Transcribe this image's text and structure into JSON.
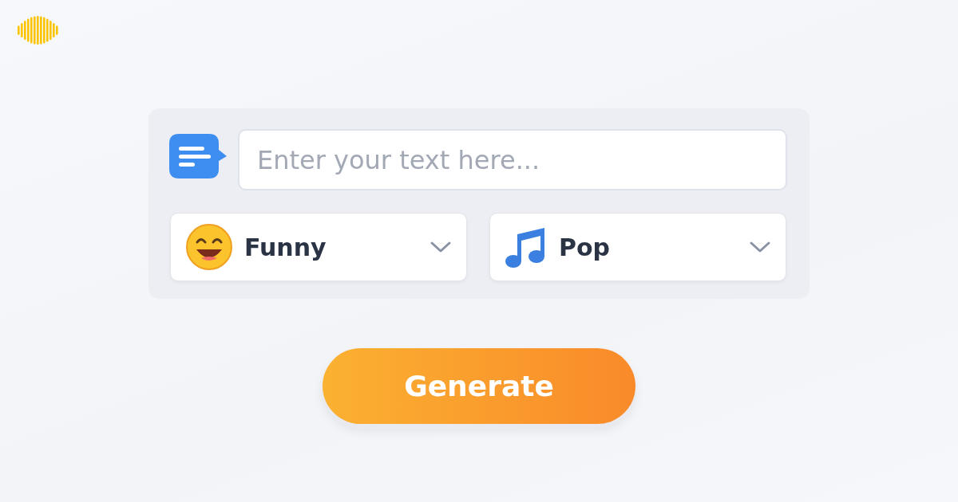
{
  "prompt": {
    "placeholder": "Enter your text here..."
  },
  "selects": [
    {
      "kind": "mood",
      "value": "Funny"
    },
    {
      "kind": "genre",
      "value": "Pop"
    }
  ],
  "generate_button": {
    "label": "Generate"
  }
}
